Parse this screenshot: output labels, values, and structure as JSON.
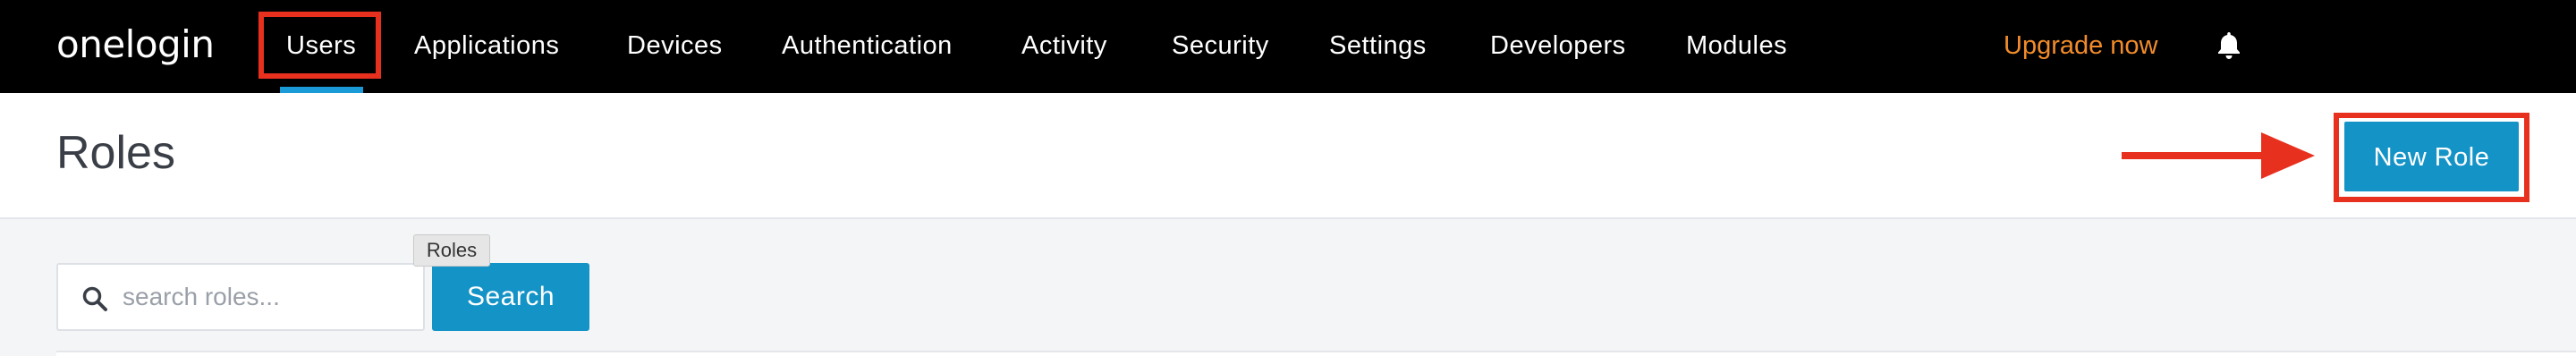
{
  "app": {
    "logo_text": "onelogin"
  },
  "nav": {
    "items": [
      {
        "label": "Users",
        "active": true
      },
      {
        "label": "Applications"
      },
      {
        "label": "Devices"
      },
      {
        "label": "Authentication"
      },
      {
        "label": "Activity"
      },
      {
        "label": "Security"
      },
      {
        "label": "Settings"
      },
      {
        "label": "Developers"
      },
      {
        "label": "Modules"
      }
    ],
    "upgrade_label": "Upgrade now",
    "notification_icon": "bell-icon"
  },
  "header": {
    "title": "Roles",
    "new_role_label": "New Role"
  },
  "search": {
    "placeholder": "search roles...",
    "value": "",
    "button_label": "Search",
    "icon": "search-icon"
  },
  "tooltip": {
    "text": "Roles"
  },
  "colors": {
    "topbar": "#000000",
    "accent": "#1493c7",
    "upgrade": "#f28c2a",
    "annotation": "#e8301f"
  }
}
